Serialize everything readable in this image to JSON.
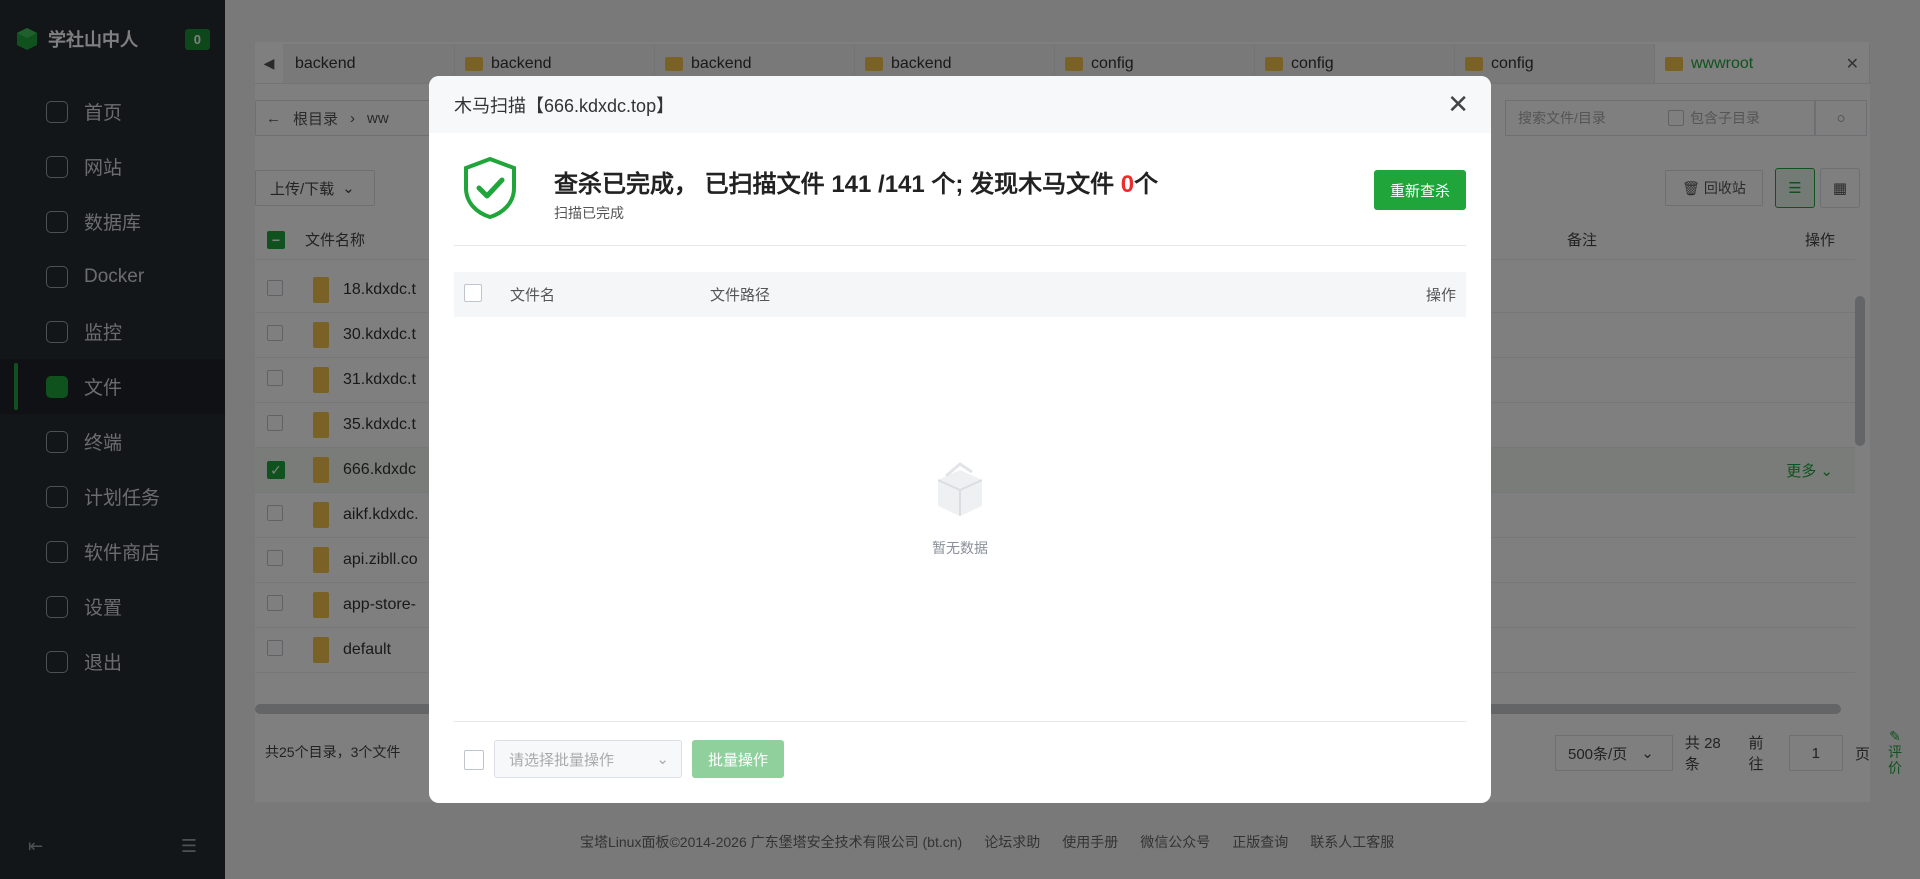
{
  "sidebar": {
    "brand": "学社山中人",
    "badge": "0",
    "items": [
      {
        "label": "首页",
        "icon": "home-icon"
      },
      {
        "label": "网站",
        "icon": "website-icon"
      },
      {
        "label": "数据库",
        "icon": "database-icon"
      },
      {
        "label": "Docker",
        "icon": "docker-icon"
      },
      {
        "label": "监控",
        "icon": "monitor-icon"
      },
      {
        "label": "文件",
        "icon": "folder-icon",
        "active": true
      },
      {
        "label": "终端",
        "icon": "terminal-icon"
      },
      {
        "label": "计划任务",
        "icon": "calendar-icon"
      },
      {
        "label": "软件商店",
        "icon": "apps-icon"
      },
      {
        "label": "设置",
        "icon": "settings-icon"
      },
      {
        "label": "退出",
        "icon": "logout-icon"
      }
    ]
  },
  "tabs": [
    {
      "label": "backend"
    },
    {
      "label": "backend"
    },
    {
      "label": "backend"
    },
    {
      "label": "backend"
    },
    {
      "label": "config"
    },
    {
      "label": "config"
    },
    {
      "label": "config"
    },
    {
      "label": "wwwroot",
      "active": true
    }
  ],
  "path": {
    "root": "根目录",
    "current": "ww"
  },
  "search": {
    "placeholder": "搜索文件/目录",
    "subdir_label": "包含子目录"
  },
  "toolbar": {
    "upload": "上传/下载",
    "recycle": "回收站"
  },
  "table": {
    "headers": {
      "name": "文件名称",
      "remark": "备注",
      "ops": "操作"
    },
    "rows": [
      {
        "name": "18.kdxdc.t"
      },
      {
        "name": "30.kdxdc.t"
      },
      {
        "name": "31.kdxdc.t"
      },
      {
        "name": "35.kdxdc.t"
      },
      {
        "name": "666.kdxdc",
        "selected": true,
        "more": "更多"
      },
      {
        "name": "aikf.kdxdc."
      },
      {
        "name": "api.zibll.co"
      },
      {
        "name": "app-store-"
      },
      {
        "name": "default"
      }
    ]
  },
  "footer_info": "共25个目录，3个文件",
  "pager": {
    "size": "500条/页",
    "total": "共 28 条",
    "goto": "前往",
    "page": "1",
    "page_suffix": "页"
  },
  "page_footer": {
    "copyright": "宝塔Linux面板©2014-2026 广东堡塔安全技术有限公司 (bt.cn)",
    "links": [
      "论坛求助",
      "使用手册",
      "微信公众号",
      "正版查询",
      "联系人工客服"
    ]
  },
  "eval_label": "评价",
  "modal": {
    "title": "木马扫描【666.kdxdc.top】",
    "summary_prefix": "查杀已完成， 已扫描文件 141 /141 个; 发现木马文件 ",
    "found_count": "0",
    "summary_suffix": "个",
    "subtitle": "扫描已完成",
    "rescan": "重新查杀",
    "headers": {
      "filename": "文件名",
      "filepath": "文件路径",
      "ops": "操作"
    },
    "empty": "暂无数据",
    "batch_placeholder": "请选择批量操作",
    "batch_button": "批量操作"
  },
  "colors": {
    "accent": "#20a53a",
    "danger": "#ef2b2b",
    "sidebar": "#262c33"
  }
}
